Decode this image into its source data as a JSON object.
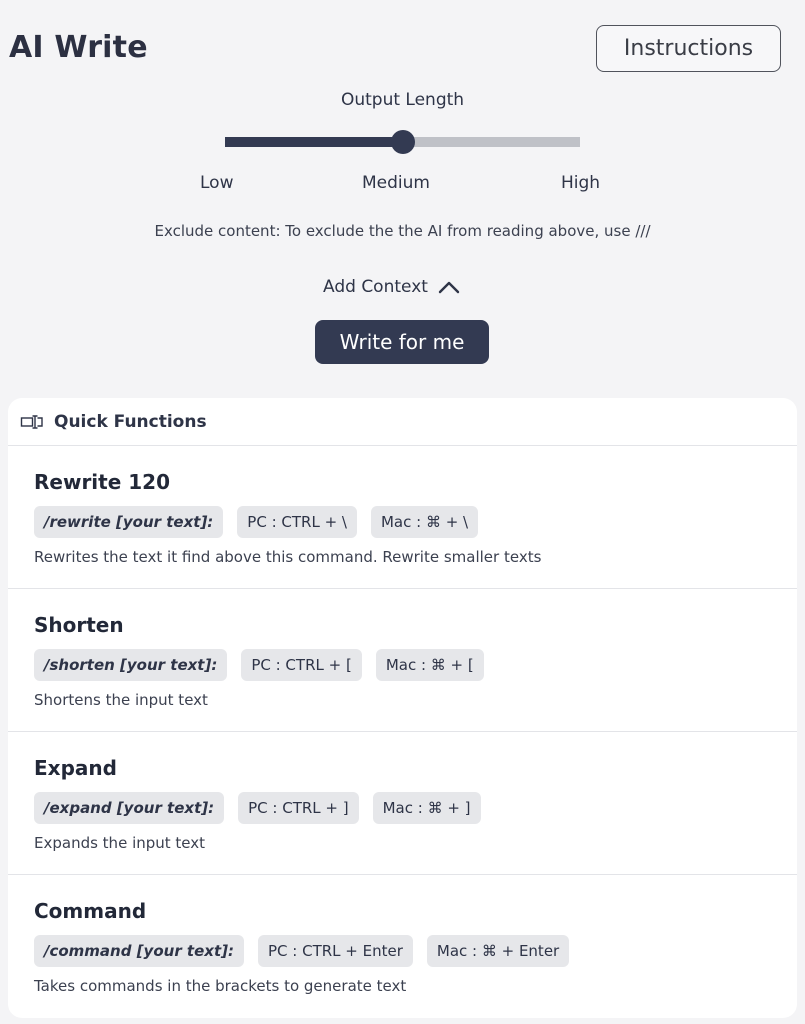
{
  "header": {
    "title": "AI Write",
    "instructions_label": "Instructions"
  },
  "output_length": {
    "label": "Output Length",
    "ticks": {
      "low": "Low",
      "medium": "Medium",
      "high": "High"
    },
    "value_fraction": 0.5
  },
  "exclude_note": "Exclude content: To exclude the the AI from reading above, use ///",
  "add_context": {
    "label": "Add Context",
    "icon": "chevron-up-icon"
  },
  "write_button": {
    "label": "Write for me"
  },
  "quick_functions": {
    "title": "Quick Functions",
    "icon": "text-cursor-icon",
    "items": [
      {
        "title": "Rewrite 120",
        "command": "/rewrite [your text]:",
        "pc": "PC : CTRL + \\",
        "mac": "Mac : ⌘ + \\",
        "description": "Rewrites the text it find above this command. Rewrite smaller texts"
      },
      {
        "title": "Shorten",
        "command": "/shorten [your text]:",
        "pc": "PC : CTRL + [",
        "mac": "Mac : ⌘ + [",
        "description": "Shortens the input text"
      },
      {
        "title": "Expand",
        "command": "/expand [your text]:",
        "pc": "PC : CTRL + ]",
        "mac": "Mac : ⌘ + ]",
        "description": "Expands the input text"
      },
      {
        "title": "Command",
        "command": "/command [your text]:",
        "pc": "PC : CTRL + Enter",
        "mac": "Mac : ⌘ + Enter",
        "description": "Takes commands in the brackets to generate text"
      }
    ]
  },
  "colors": {
    "accent": "#333a52",
    "background": "#f4f4f6",
    "chip": "#e6e7ea"
  }
}
